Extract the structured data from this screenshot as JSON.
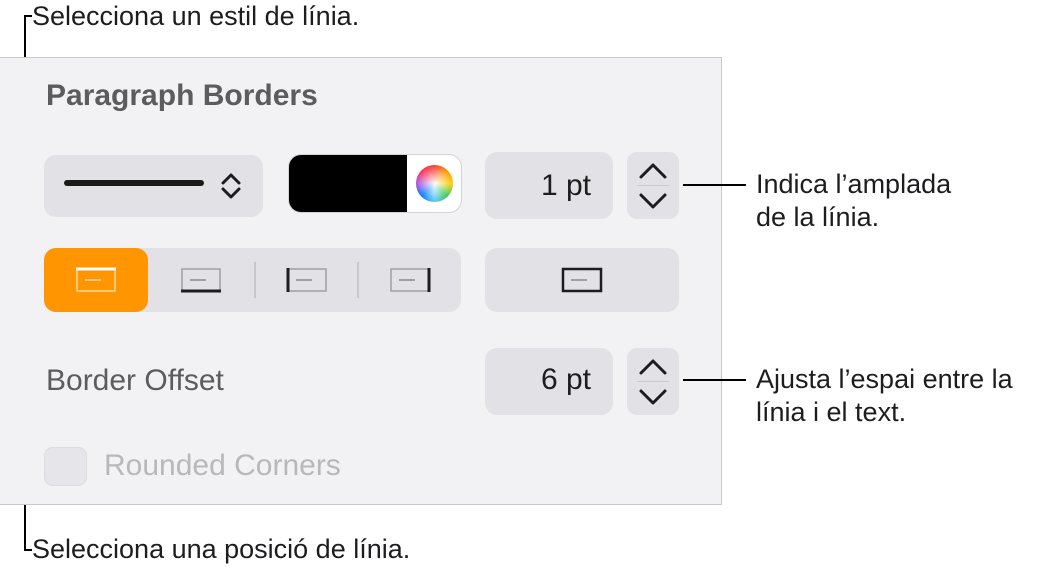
{
  "annotations": {
    "line_style": "Selecciona un estil de línia.",
    "width_line1": "Indica l’amplada",
    "width_line2": "de la línia.",
    "offset_line1": "Ajusta l’espai entre la",
    "offset_line2": "línia i el text.",
    "position": "Selecciona una posició de línia."
  },
  "panel": {
    "title": "Paragraph Borders",
    "line_style": {
      "selected": "solid",
      "icon": "chevron-up-down-icon"
    },
    "color": {
      "value": "#000000",
      "picker_icon": "color-wheel-icon"
    },
    "line_width": {
      "value": "1 pt"
    },
    "border_positions": {
      "selected": "top",
      "options": [
        "top",
        "bottom",
        "left",
        "right"
      ],
      "outline": "all-sides",
      "accent": "#ff9500"
    },
    "border_offset": {
      "label": "Border Offset",
      "value": "6 pt"
    },
    "rounded_corners": {
      "label": "Rounded Corners",
      "checked": false,
      "enabled": false
    }
  }
}
